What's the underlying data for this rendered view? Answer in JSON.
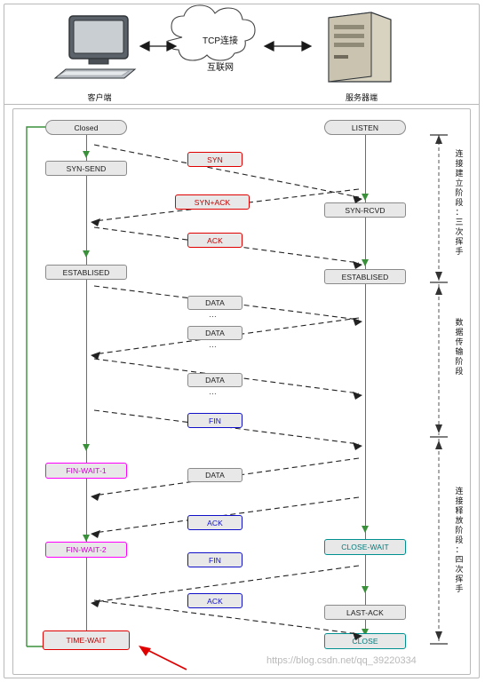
{
  "diagram": {
    "title_cloud_top": "TCP连接",
    "title_cloud_bottom": "互联网",
    "client_caption": "客户端",
    "server_caption": "服务器端",
    "watermark": "https://blog.csdn.net/qq_39220334",
    "ellipsis": "…"
  },
  "client_states": [
    {
      "label": "Closed",
      "style": "round"
    },
    {
      "label": "SYN-SEND",
      "style": "plain"
    },
    {
      "label": "ESTABLISED",
      "style": "plain"
    },
    {
      "label": "FIN-WAIT-1",
      "style": "magenta"
    },
    {
      "label": "FIN-WAIT-2",
      "style": "magenta"
    },
    {
      "label": "TIME-WAIT",
      "style": "redline"
    }
  ],
  "server_states": [
    {
      "label": "LISTEN",
      "style": "round"
    },
    {
      "label": "SYN-RCVD",
      "style": "plain"
    },
    {
      "label": "ESTABLISED",
      "style": "plain"
    },
    {
      "label": "CLOSE-WAIT",
      "style": "tealline"
    },
    {
      "label": "LAST-ACK",
      "style": "plain"
    },
    {
      "label": "CLOSE",
      "style": "tealline"
    }
  ],
  "messages": [
    {
      "label": "SYN",
      "style": "redline",
      "dir": "c2s"
    },
    {
      "label": "SYN+ACK",
      "style": "redline",
      "dir": "s2c"
    },
    {
      "label": "ACK",
      "style": "redline",
      "dir": "c2s"
    },
    {
      "label": "DATA",
      "style": "plain",
      "dir": "c2s"
    },
    {
      "label": "DATA",
      "style": "plain",
      "dir": "s2c"
    },
    {
      "label": "DATA",
      "style": "plain",
      "dir": "c2s"
    },
    {
      "label": "FIN",
      "style": "blueline",
      "dir": "c2s"
    },
    {
      "label": "DATA",
      "style": "plain",
      "dir": "s2c"
    },
    {
      "label": "ACK",
      "style": "blueline",
      "dir": "s2c"
    },
    {
      "label": "FIN",
      "style": "blueline",
      "dir": "s2c"
    },
    {
      "label": "ACK",
      "style": "blueline",
      "dir": "c2s"
    }
  ],
  "phases": [
    {
      "label": "连接建立阶段：三次挥手"
    },
    {
      "label": "数据传输阶段"
    },
    {
      "label": "连接释放阶段：四次挥手"
    }
  ]
}
